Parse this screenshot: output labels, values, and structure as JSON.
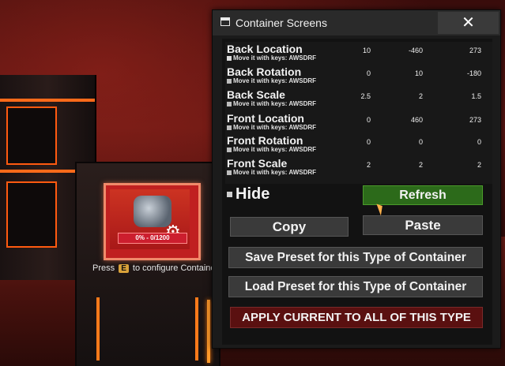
{
  "window": {
    "title": "Container Screens",
    "close_label": "✕"
  },
  "properties": [
    {
      "name": "Back Location",
      "sub": "Move it with keys: AWSDRF",
      "checked": true,
      "values": [
        "10",
        "-460",
        "273"
      ]
    },
    {
      "name": "Back Rotation",
      "sub": "Move it with keys: AWSDRF",
      "checked": false,
      "values": [
        "0",
        "10",
        "-180"
      ]
    },
    {
      "name": "Back Scale",
      "sub": "Move it with keys: AWSDRF",
      "checked": false,
      "values": [
        "2.5",
        "2",
        "1.5"
      ]
    },
    {
      "name": "Front Location",
      "sub": "Move it with keys: AWSDRF",
      "checked": false,
      "values": [
        "0",
        "460",
        "273"
      ]
    },
    {
      "name": "Front Rotation",
      "sub": "Move it with keys: AWSDRF",
      "checked": false,
      "values": [
        "0",
        "0",
        "0"
      ]
    },
    {
      "name": "Front Scale",
      "sub": "Move it with keys: AWSDRF",
      "checked": false,
      "values": [
        "2",
        "2",
        "2"
      ]
    }
  ],
  "hide_label": "Hide",
  "buttons": {
    "refresh": "Refresh",
    "copy": "Copy",
    "paste": "Paste",
    "save_preset": "Save Preset for this Type of Container",
    "load_preset": "Load Preset for this Type of Container",
    "apply_all": "APPLY CURRENT TO ALL OF THIS TYPE"
  },
  "scene": {
    "card_progress": "0% - 0/1200",
    "hint_prefix": "Press",
    "hint_key": "E",
    "hint_suffix": "to configure Containe"
  },
  "colors": {
    "refresh_bg": "#2c6a1a",
    "apply_bg": "#5a1010",
    "accent_orange": "#ff6a1a"
  }
}
